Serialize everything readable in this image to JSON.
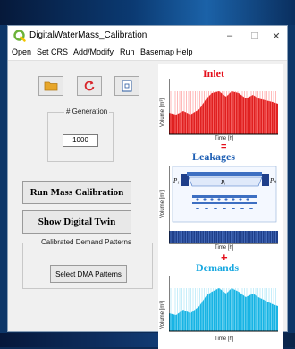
{
  "window": {
    "title": "DigitalWaterMass_Calibration",
    "controls": {
      "minimize": "–",
      "maximize": "☐",
      "close": "✕"
    }
  },
  "menu": [
    "Open",
    "Set CRS",
    "Add/Modify",
    "Run",
    "Basemap",
    "Help"
  ],
  "toolbar": [
    {
      "icon": "folder-icon"
    },
    {
      "icon": "refresh-icon"
    },
    {
      "icon": "document-icon"
    }
  ],
  "generation": {
    "label": "# Generation",
    "value": "1000"
  },
  "buttons": {
    "run_mass_calibration": "Run Mass Calibration",
    "show_digital_twin": "Show Digital Twin"
  },
  "demand_group": {
    "label": "Calibrated Demand Patterns",
    "button": "Select DMA Patterns"
  },
  "panel": {
    "inlet": {
      "title": "Inlet",
      "ylabel": "Volume [m³]",
      "xlabel": "Time [h]",
      "color": "#e02020"
    },
    "equals": "=",
    "leakages": {
      "title": "Leakages",
      "ylabel": "Volume [m³]",
      "xlabel": "Time [h]",
      "color": "#1f3f8a",
      "labels": {
        "p1": "P₁",
        "pi": "Pᵢ",
        "pn": "Pₙ"
      }
    },
    "plus": "+",
    "demands": {
      "title": "Demands",
      "ylabel": "Volume [m³]",
      "xlabel": "Time [h]",
      "color": "#18b4e4"
    }
  },
  "colors": {
    "title_red": "#e4101c",
    "title_blue": "#1e5fb4",
    "title_cyan": "#18a8e0",
    "operator_red": "#e4101c"
  }
}
